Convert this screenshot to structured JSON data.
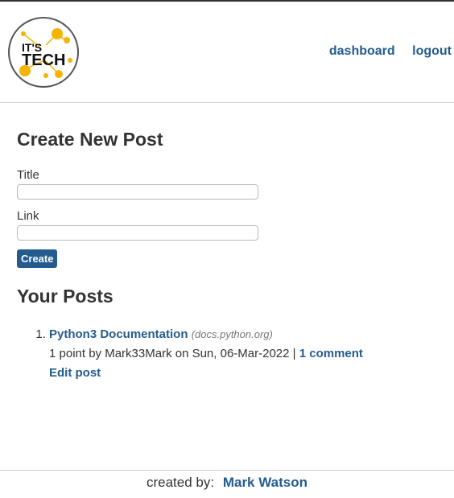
{
  "logo": {
    "line1": "IT'S",
    "line2": "TECH",
    "accent_color": "#f5b400"
  },
  "nav": {
    "dashboard": "dashboard",
    "logout": "logout"
  },
  "create": {
    "heading": "Create New Post",
    "title_label": "Title",
    "title_value": "",
    "link_label": "Link",
    "link_value": "",
    "button": "Create"
  },
  "posts": {
    "heading": "Your Posts",
    "items": [
      {
        "title": "Python3 Documentation",
        "domain": "(docs.python.org)",
        "meta": "1 point by Mark33Mark on Sun, 06-Mar-2022 | ",
        "comments": "1 comment",
        "edit": "Edit post"
      }
    ]
  },
  "footer": {
    "prefix": "created by:",
    "author": "Mark Watson"
  },
  "colors": {
    "link": "#245c8f",
    "text": "#333333",
    "button": "#245c8f"
  }
}
